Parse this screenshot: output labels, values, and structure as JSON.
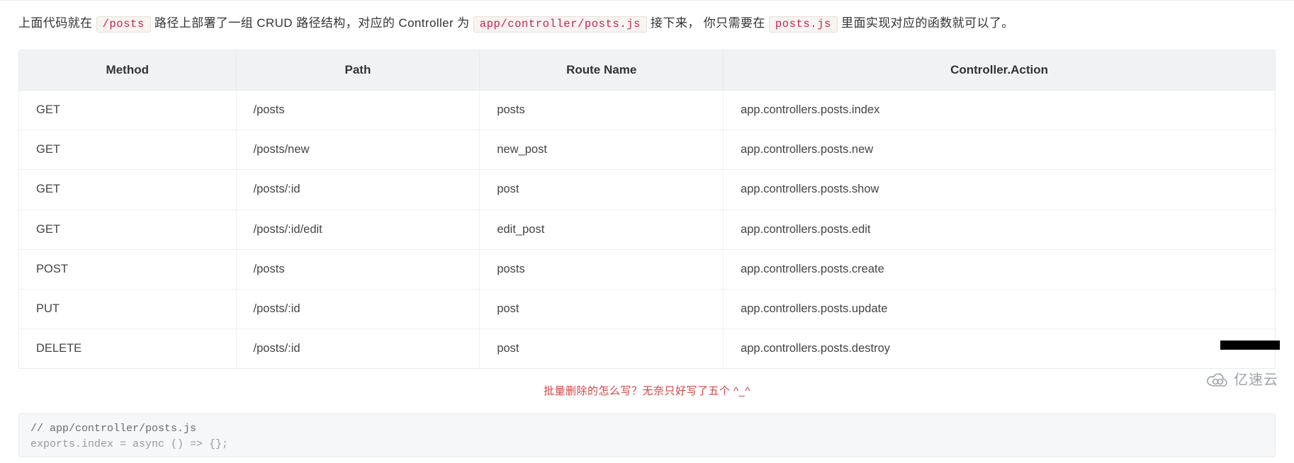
{
  "intro": {
    "t1": "上面代码就在 ",
    "code1": "/posts",
    "t2": " 路径上部署了一组 CRUD 路径结构，对应的 Controller 为 ",
    "code2": "app/controller/posts.js",
    "t3": " 接下来， 你只需要在 ",
    "code3": "posts.js",
    "t4": " 里面实现对应的函数就可以了。"
  },
  "table": {
    "headers": [
      "Method",
      "Path",
      "Route Name",
      "Controller.Action"
    ],
    "rows": [
      {
        "method": "GET",
        "path": "/posts",
        "route": "posts",
        "action": "app.controllers.posts.index"
      },
      {
        "method": "GET",
        "path": "/posts/new",
        "route": "new_post",
        "action": "app.controllers.posts.new"
      },
      {
        "method": "GET",
        "path": "/posts/:id",
        "route": "post",
        "action": "app.controllers.posts.show"
      },
      {
        "method": "GET",
        "path": "/posts/:id/edit",
        "route": "edit_post",
        "action": "app.controllers.posts.edit"
      },
      {
        "method": "POST",
        "path": "/posts",
        "route": "posts",
        "action": "app.controllers.posts.create"
      },
      {
        "method": "PUT",
        "path": "/posts/:id",
        "route": "post",
        "action": "app.controllers.posts.update"
      },
      {
        "method": "DELETE",
        "path": "/posts/:id",
        "route": "post",
        "action": "app.controllers.posts.destroy"
      }
    ]
  },
  "annotation": "批量删除的怎么写？无奈只好写了五个  ^_^",
  "code": {
    "line1": "// app/controller/posts.js",
    "line2": "exports.index = async () => {};"
  },
  "brand": "亿速云"
}
